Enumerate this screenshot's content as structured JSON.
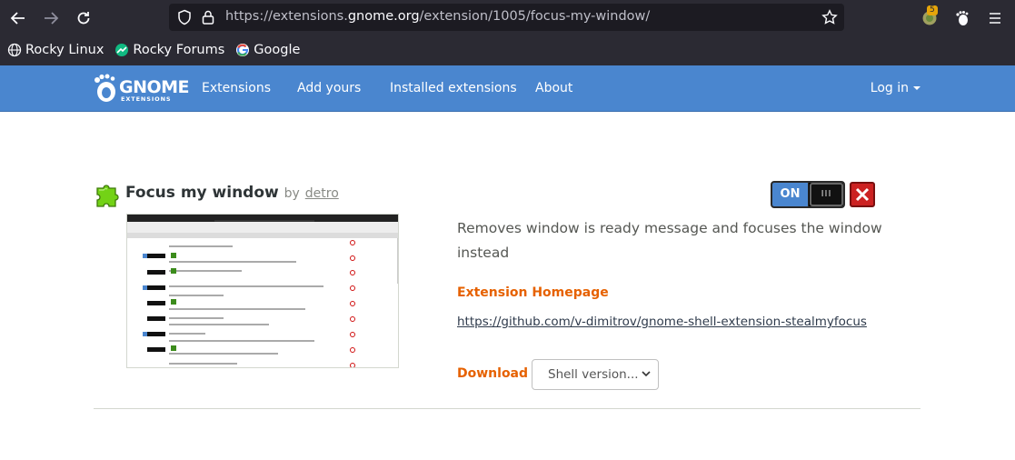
{
  "browser": {
    "url_prefix": "https://extensions.",
    "url_host": "gnome.org",
    "url_path": "/extension/1005/focus-my-window/",
    "extensions_badge": "5",
    "bookmarks": [
      {
        "label": "Rocky Linux",
        "icon": "globe-icon"
      },
      {
        "label": "Rocky Forums",
        "icon": "rocky-forums-icon"
      },
      {
        "label": "Google",
        "icon": "google-icon"
      }
    ]
  },
  "site": {
    "logo_main": "GNOME",
    "logo_sub": "EXTENSIONS",
    "nav": [
      "Extensions",
      "Add yours",
      "Installed extensions",
      "About"
    ],
    "login": "Log in"
  },
  "extension": {
    "name": "Focus my window",
    "by": "by",
    "author": "detro",
    "description": "Removes window is ready message and focuses the window instead",
    "homepage_label": "Extension Homepage",
    "homepage_url": "https://github.com/v-dimitrov/gnome-shell-extension-stealmyfocus",
    "download_label": "Download",
    "shell_version_placeholder": "Shell version...",
    "toggle_state": "ON",
    "toggle_knob": "III"
  },
  "colors": {
    "accent_orange": "#e66100",
    "gnome_blue": "#4a86cf",
    "remove_red": "#cc2222"
  }
}
